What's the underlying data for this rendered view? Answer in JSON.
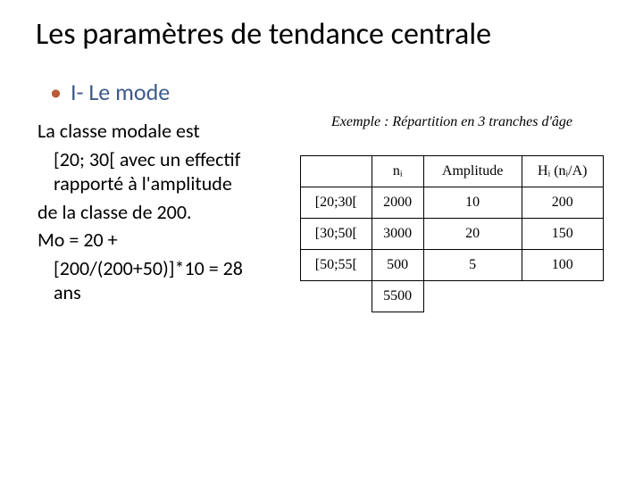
{
  "title": "Les paramètres de tendance centrale",
  "bullet": "I- Le mode",
  "body": {
    "p1a": "La classe modale est",
    "p1b": "[20; 30[ avec un effectif rapporté à l'amplitude",
    "p2": "de la classe de 200.",
    "p3a": "Mo = 20 +",
    "p3b": "[200/(200+50)]*10 = 28 ans"
  },
  "caption": "Exemple : Répartition en 3 tranches d'âge",
  "chart_data": {
    "type": "table",
    "headers": [
      "",
      "nᵢ",
      "Amplitude",
      "Hᵢ (nᵢ/A)"
    ],
    "rows": [
      [
        "[20;30[",
        "2000",
        "10",
        "200"
      ],
      [
        "[30;50[",
        "3000",
        "20",
        "150"
      ],
      [
        "[50;55[",
        "500",
        "5",
        "100"
      ]
    ],
    "total": [
      "",
      "5500",
      "",
      ""
    ]
  }
}
